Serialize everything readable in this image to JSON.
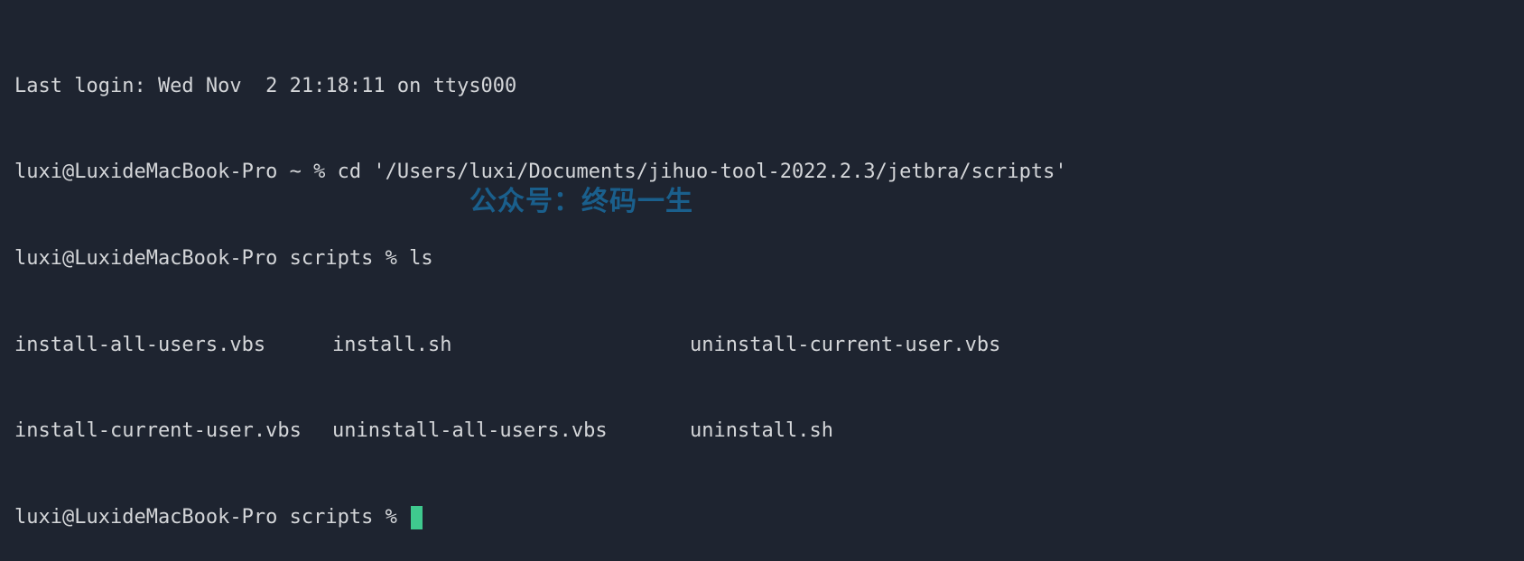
{
  "colors": {
    "bg": "#1e2430",
    "fg": "#d4d6d9",
    "cursor": "#3fc98e",
    "watermark": "#1a5f8c"
  },
  "last_login": "Last login: Wed Nov  2 21:18:11 on ttys000",
  "lines": [
    {
      "prompt": "luxi@LuxideMacBook-Pro ~ % ",
      "cmd": "cd '/Users/luxi/Documents/jihuo-tool-2022.2.3/jetbra/scripts'"
    },
    {
      "prompt": "luxi@LuxideMacBook-Pro scripts % ",
      "cmd": "ls"
    }
  ],
  "ls": {
    "col1": [
      "install-all-users.vbs",
      "install-current-user.vbs"
    ],
    "col2": [
      "install.sh",
      "uninstall-all-users.vbs"
    ],
    "col3": [
      "uninstall-current-user.vbs",
      "uninstall.sh"
    ]
  },
  "current_prompt": "luxi@LuxideMacBook-Pro scripts % ",
  "watermark": "公众号：终码一生"
}
